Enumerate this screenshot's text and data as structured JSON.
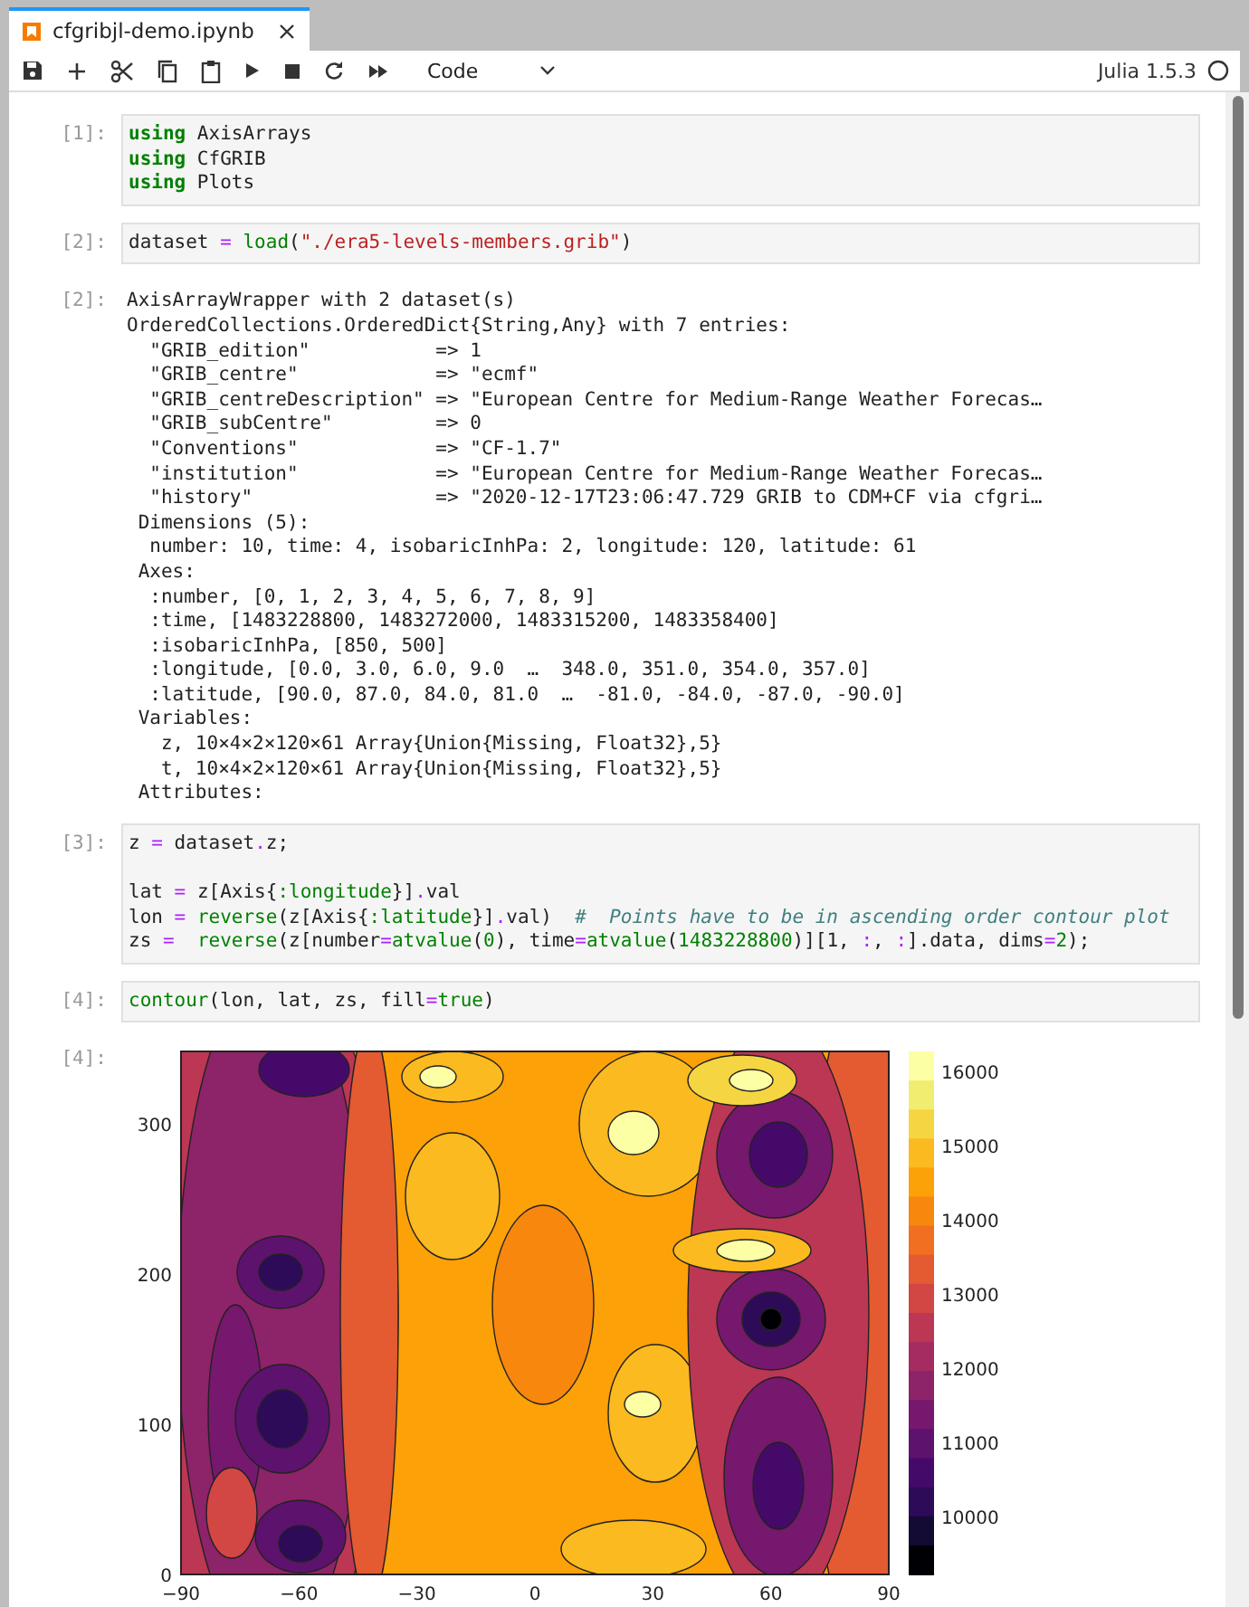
{
  "tab": {
    "title": "cfgribjl-demo.ipynb"
  },
  "toolbar": {
    "cell_type": "Code",
    "kernel": "Julia 1.5.3",
    "kernel_busy": false
  },
  "cells": [
    {
      "kind": "code",
      "prompt": "[1]:",
      "blocks": [
        [
          [
            {
              "kind": "kw",
              "text": "using"
            },
            {
              "kind": "p",
              "text": " AxisArrays"
            }
          ],
          [
            {
              "kind": "kw",
              "text": "using"
            },
            {
              "kind": "p",
              "text": " CfGRIB"
            }
          ],
          [
            {
              "kind": "kw",
              "text": "using"
            },
            {
              "kind": "p",
              "text": " Plots"
            }
          ]
        ]
      ]
    },
    {
      "kind": "code",
      "prompt": "[2]:",
      "blocks": [
        [
          [
            {
              "kind": "p",
              "text": "dataset "
            },
            {
              "kind": "op",
              "text": "="
            },
            {
              "kind": "fn",
              "text": " load"
            },
            {
              "kind": "p",
              "text": "("
            },
            {
              "kind": "str",
              "text": "\"./era5-levels-members.grib\""
            },
            {
              "kind": "p",
              "text": ")"
            }
          ]
        ]
      ]
    },
    {
      "kind": "text_output",
      "prompt": "[2]:",
      "lines": [
        "AxisArrayWrapper with 2 dataset(s)",
        "OrderedCollections.OrderedDict{String,Any} with 7 entries:",
        "  \"GRIB_edition\"           => 1",
        "  \"GRIB_centre\"            => \"ecmf\"",
        "  \"GRIB_centreDescription\" => \"European Centre for Medium-Range Weather Forecas…",
        "  \"GRIB_subCentre\"         => 0",
        "  \"Conventions\"            => \"CF-1.7\"",
        "  \"institution\"            => \"European Centre for Medium-Range Weather Forecas…",
        "  \"history\"                => \"2020-12-17T23:06:47.729 GRIB to CDM+CF via cfgri…",
        " Dimensions (5):",
        "  number: 10, time: 4, isobaricInhPa: 2, longitude: 120, latitude: 61",
        " Axes:",
        "  :number, [0, 1, 2, 3, 4, 5, 6, 7, 8, 9]",
        "  :time, [1483228800, 1483272000, 1483315200, 1483358400]",
        "  :isobaricInhPa, [850, 500]",
        "  :longitude, [0.0, 3.0, 6.0, 9.0  …  348.0, 351.0, 354.0, 357.0]",
        "  :latitude, [90.0, 87.0, 84.0, 81.0  …  -81.0, -84.0, -87.0, -90.0]",
        " Variables:",
        "   z, 10×4×2×120×61 Array{Union{Missing, Float32},5}",
        "   t, 10×4×2×120×61 Array{Union{Missing, Float32},5}",
        " Attributes:"
      ]
    },
    {
      "kind": "code",
      "prompt": "[3]:",
      "blocks": [
        [
          [
            {
              "kind": "p",
              "text": "z "
            },
            {
              "kind": "op",
              "text": "="
            },
            {
              "kind": "p",
              "text": " dataset"
            },
            {
              "kind": "op",
              "text": "."
            },
            {
              "kind": "p",
              "text": "z;"
            }
          ]
        ],
        [
          [
            {
              "kind": "p",
              "text": "lat "
            },
            {
              "kind": "op",
              "text": "="
            },
            {
              "kind": "p",
              "text": " z[Axis{"
            },
            {
              "kind": "lit",
              "text": ":longitude"
            },
            {
              "kind": "p",
              "text": "}]"
            },
            {
              "kind": "op",
              "text": "."
            },
            {
              "kind": "p",
              "text": "val"
            }
          ],
          [
            {
              "kind": "p",
              "text": "lon "
            },
            {
              "kind": "op",
              "text": "="
            },
            {
              "kind": "fn",
              "text": " reverse"
            },
            {
              "kind": "p",
              "text": "(z[Axis{"
            },
            {
              "kind": "lit",
              "text": ":latitude"
            },
            {
              "kind": "p",
              "text": "}]"
            },
            {
              "kind": "op",
              "text": "."
            },
            {
              "kind": "p",
              "text": "val)  "
            },
            {
              "kind": "cm",
              "text": "#  Points have to be in ascending order contour plot"
            }
          ],
          [
            {
              "kind": "p",
              "text": "zs "
            },
            {
              "kind": "op",
              "text": "="
            },
            {
              "kind": "fn",
              "text": "  reverse"
            },
            {
              "kind": "p",
              "text": "(z[number"
            },
            {
              "kind": "op",
              "text": "="
            },
            {
              "kind": "fn",
              "text": "atvalue"
            },
            {
              "kind": "p",
              "text": "("
            },
            {
              "kind": "lit",
              "text": "0"
            },
            {
              "kind": "p",
              "text": "), time"
            },
            {
              "kind": "op",
              "text": "="
            },
            {
              "kind": "fn",
              "text": "atvalue"
            },
            {
              "kind": "p",
              "text": "("
            },
            {
              "kind": "lit",
              "text": "1483228800"
            },
            {
              "kind": "p",
              "text": ")][1, "
            },
            {
              "kind": "op",
              "text": ":"
            },
            {
              "kind": "p",
              "text": ", "
            },
            {
              "kind": "op",
              "text": ":"
            },
            {
              "kind": "p",
              "text": "].data, dims"
            },
            {
              "kind": "op",
              "text": "="
            },
            {
              "kind": "lit",
              "text": "2"
            },
            {
              "kind": "p",
              "text": ");"
            }
          ]
        ]
      ]
    },
    {
      "kind": "code",
      "prompt": "[4]:",
      "blocks": [
        [
          [
            {
              "kind": "fn",
              "text": "contour"
            },
            {
              "kind": "p",
              "text": "(lon, lat, zs, fill"
            },
            {
              "kind": "op",
              "text": "="
            },
            {
              "kind": "lit",
              "text": "true"
            },
            {
              "kind": "p",
              "text": ")"
            }
          ]
        ]
      ]
    },
    {
      "kind": "plot",
      "prompt": "[4]:",
      "x_ticks": [
        "−90",
        "−60",
        "−30",
        "0",
        "30",
        "60",
        "90"
      ],
      "y_ticks": [
        "300",
        "200",
        "100",
        "0"
      ],
      "colorbar_ticks": [
        "16000",
        "15000",
        "14000",
        "13000",
        "12000",
        "11000",
        "10000"
      ]
    }
  ]
}
